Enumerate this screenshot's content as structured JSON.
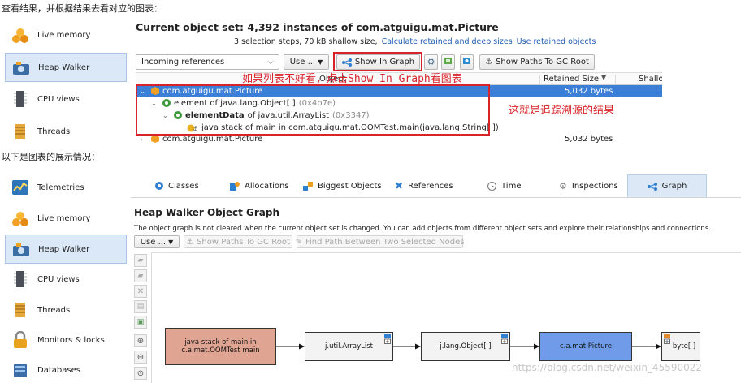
{
  "captions": {
    "top": "查看结果，并根据结果去看对应的图表：",
    "middle": "以下是图表的展示情况："
  },
  "top_sidebar": [
    {
      "label": "Live memory",
      "icon": "live-memory-icon"
    },
    {
      "label": "Heap Walker",
      "icon": "heap-walker-icon",
      "selected": true
    },
    {
      "label": "CPU views",
      "icon": "cpu-views-icon"
    },
    {
      "label": "Threads",
      "icon": "threads-icon"
    }
  ],
  "object_set": {
    "title": "Current object set:  4,392 instances of com.atguigu.mat.Picture",
    "steps_text": "3 selection steps, 70 kB shallow size,",
    "link_calc": "Calculate retained and deep sizes",
    "link_use": "Use retained objects"
  },
  "toolbar": {
    "view_select": "Incoming references",
    "use_button": "Use ...",
    "show_in_graph": "Show In Graph",
    "show_paths": "Show Paths To GC Root"
  },
  "table": {
    "columns": [
      "Object",
      "Retained Size",
      "Shallo"
    ],
    "rows": [
      {
        "text": "com.atguigu.mat.Picture",
        "size": "5,032 bytes",
        "selected": true,
        "level": 0
      },
      {
        "text": "element of java.lang.Object[ ]",
        "suffix": "(0x4b7e)",
        "size": "",
        "level": 1
      },
      {
        "text": "elementData",
        "text2": "of java.util.ArrayList",
        "suffix": "(0x3347)",
        "size": "",
        "level": 2
      },
      {
        "text": "java stack of main in com.atguigu.mat.OOMTest.main(java.lang.String[ ])",
        "size": "",
        "level": 3
      },
      {
        "text": "com.atguigu.mat.Picture",
        "size": "5,032 bytes",
        "level": 0
      }
    ]
  },
  "annotations": {
    "hint": "如果列表不好看，点击Show In Graph看图表",
    "result": "这就是追踪溯源的结果"
  },
  "bottom_sidebar": [
    {
      "label": "Telemetries",
      "icon": "telemetries-icon"
    },
    {
      "label": "Live memory",
      "icon": "live-memory-icon"
    },
    {
      "label": "Heap Walker",
      "icon": "heap-walker-icon",
      "selected": true
    },
    {
      "label": "CPU views",
      "icon": "cpu-views-icon"
    },
    {
      "label": "Threads",
      "icon": "threads-icon"
    },
    {
      "label": "Monitors & locks",
      "icon": "monitors-icon"
    },
    {
      "label": "Databases",
      "icon": "databases-icon"
    }
  ],
  "tabs": [
    {
      "label": "Classes",
      "icon": "classes-icon"
    },
    {
      "label": "Allocations",
      "icon": "allocations-icon"
    },
    {
      "label": "Biggest Objects",
      "icon": "biggest-objects-icon"
    },
    {
      "label": "References",
      "icon": "references-icon"
    },
    {
      "label": "Time",
      "icon": "time-icon"
    },
    {
      "label": "Inspections",
      "icon": "inspections-icon"
    },
    {
      "label": "Graph",
      "icon": "graph-icon",
      "active": true
    }
  ],
  "graph": {
    "title": "Heap Walker Object Graph",
    "description": "The object graph is not cleared when the current object set is changed. You can add objects from different object sets and explore their relationships and connections.",
    "use_button": "Use ...",
    "show_paths": "Show Paths To GC Root",
    "find_path": "Find Path Between Two Selected Nodes",
    "nodes": [
      {
        "label": "java stack of main in c.a.mat.OOMTest main",
        "color": "#e0a493"
      },
      {
        "label": "j.util.ArrayList",
        "color": "#f3f3f3"
      },
      {
        "label": "j.lang.Object[ ]",
        "color": "#f3f3f3"
      },
      {
        "label": "c.a.mat.Picture",
        "color": "#6f9be8"
      },
      {
        "label": "byte[ ]",
        "color": "#f3f3f3"
      }
    ]
  },
  "watermark": "https://blog.csdn.net/weixin_45590022",
  "colors": {
    "accent_red": "#d9232a",
    "selection_blue": "#3c7fd6",
    "sidebar_selected": "#dbe8f7"
  }
}
